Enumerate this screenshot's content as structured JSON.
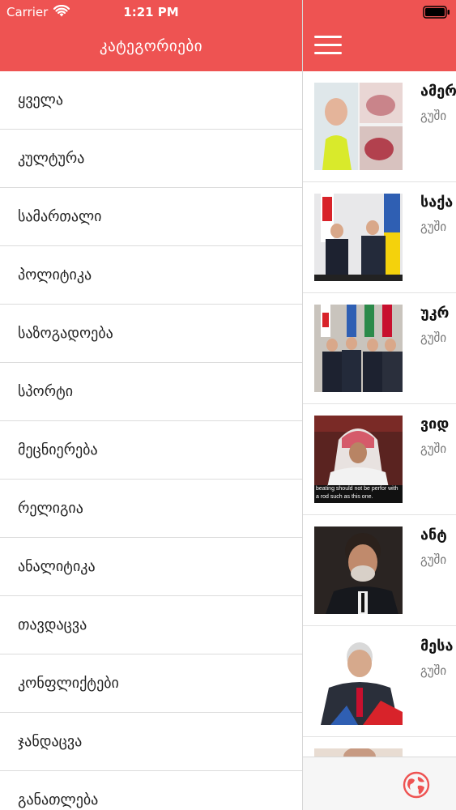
{
  "status_bar": {
    "carrier": "Carrier",
    "time": "1:21 PM"
  },
  "drawer": {
    "title": "კატეგორიები",
    "categories": [
      "ყველა",
      "კულტურა",
      "სამართალი",
      "პოლიტიკა",
      "საზოგადოება",
      "სპორტი",
      "მეცნიერება",
      "რელიგია",
      "ანალიტიკა",
      "თავდაცვა",
      "კონფლიქტები",
      "ჯანდაცვა",
      "განათლება"
    ]
  },
  "feed": {
    "items": [
      {
        "title": "ამერ",
        "source": "გუში",
        "icon": "photo-woman-and-newborn"
      },
      {
        "title": "საქა",
        "source": "გუში",
        "icon": "photo-handshake-flags"
      },
      {
        "title": "უკრ",
        "source": "გუში",
        "icon": "photo-leaders-group"
      },
      {
        "title": "ვიდ",
        "source": "გუში",
        "icon": "photo-man-keffiyeh"
      },
      {
        "title": "ანტ",
        "source": "გუში",
        "icon": "photo-bearded-man"
      },
      {
        "title": "მესა",
        "source": "გუში",
        "icon": "photo-older-man-flags"
      }
    ],
    "thumb_caption": "beating should not be perfor with a rod such as this one."
  },
  "colors": {
    "header": "#ee5352",
    "divider": "#dcdcdc"
  },
  "icons": {
    "wifi": "wifi-icon",
    "battery": "battery-icon",
    "menu": "hamburger-menu-icon",
    "globe": "globe-icon"
  }
}
